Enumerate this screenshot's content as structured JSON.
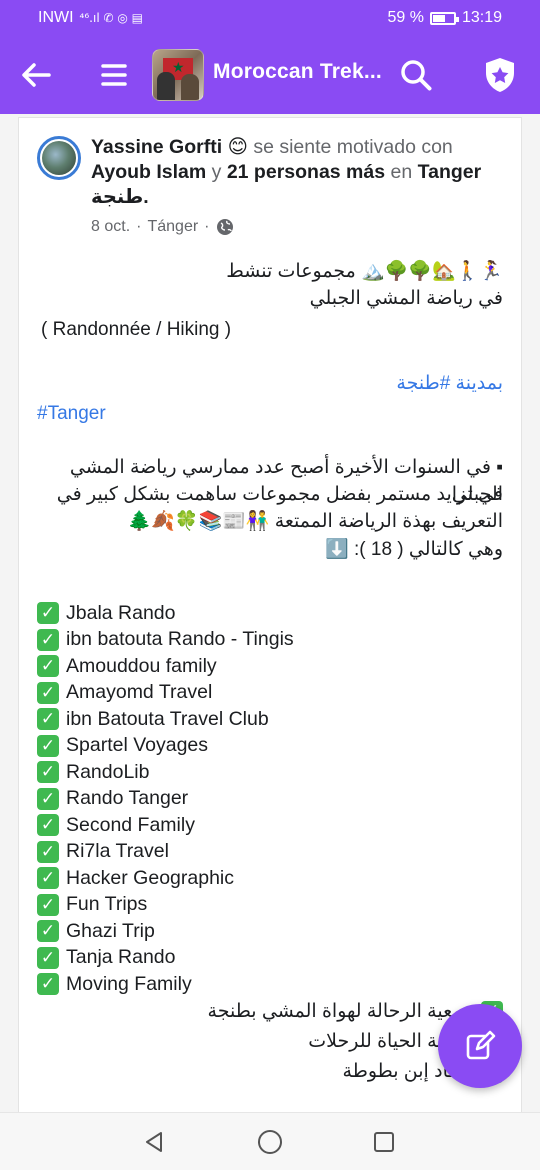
{
  "status_bar": {
    "carrier": "INWI",
    "signal_icons": "⁴⁶.ıl ✆ ◎ ▤",
    "battery_percent": "59 %",
    "battery_level": 0.59,
    "time": "13:19"
  },
  "app_bar": {
    "title": "Moroccan Trek...",
    "back_icon": "arrow-left-icon",
    "menu_icon": "hamburger-icon",
    "search_icon": "search-icon",
    "badge_icon": "shield-star-icon"
  },
  "post": {
    "author": "Yassine Gorfti",
    "feeling_emoji": "😊",
    "feeling_text": "se siente motivado con",
    "tagged_user": "Ayoub Islam",
    "connector_y": "y",
    "others": "21 personas más",
    "connector_en": "en",
    "place": "Tanger",
    "place_ar": "طنجة.",
    "date": "8 oct.",
    "sep1": "·",
    "location": "Tánger",
    "sep2": "·",
    "privacy_icon": "globe-icon",
    "lines": {
      "l1": "🏃‍♀️🚶🏡🌳🌳🏔️ مجموعات تنشط",
      "l2": "في رياضة المشي الجبلي",
      "l3": "( Randonnée / Hiking )",
      "l4": "بمدينة #طنجة",
      "l5": "#Tanger",
      "l6": "▪ في السنوات الأخيرة أصبح عدد ممارسي رياضة المشي الجبلي",
      "l7": "في تزايد مستمر بفضل  مجموعات ساهمت بشكل كبير في",
      "l8": "التعريف بهذة الرياضة الممتعة 👫📰📚🍀🍂🌲",
      "l9": "وهي كالتالي ( 18 ): ⬇️"
    },
    "groups": [
      "Jbala Rando",
      "ibn batouta Rando - Tingis",
      "Amouddou family",
      "Amayomd Travel",
      "ibn Batouta Travel Club",
      "Spartel Voyages",
      "RandoLib",
      "Rando Tanger",
      "Second Family",
      "Ri7la Travel",
      "Hacker Geographic",
      "Fun Trips",
      "Ghazi Trip",
      "Tanja Rando",
      "Moving Family"
    ],
    "ar_items": [
      "جمعية الرحالة لهواة المشي بطنجة",
      "جمعية الحياة للرحلات",
      "أحفاد إبن بطوطة"
    ]
  },
  "fab": {
    "icon": "edit-icon"
  },
  "nav": {
    "back": "back-triangle-icon",
    "home": "home-circle-icon",
    "recent": "recents-square-icon"
  },
  "colors": {
    "accent": "#8a4bf3",
    "check": "#3fb950",
    "link": "#3578e5"
  }
}
